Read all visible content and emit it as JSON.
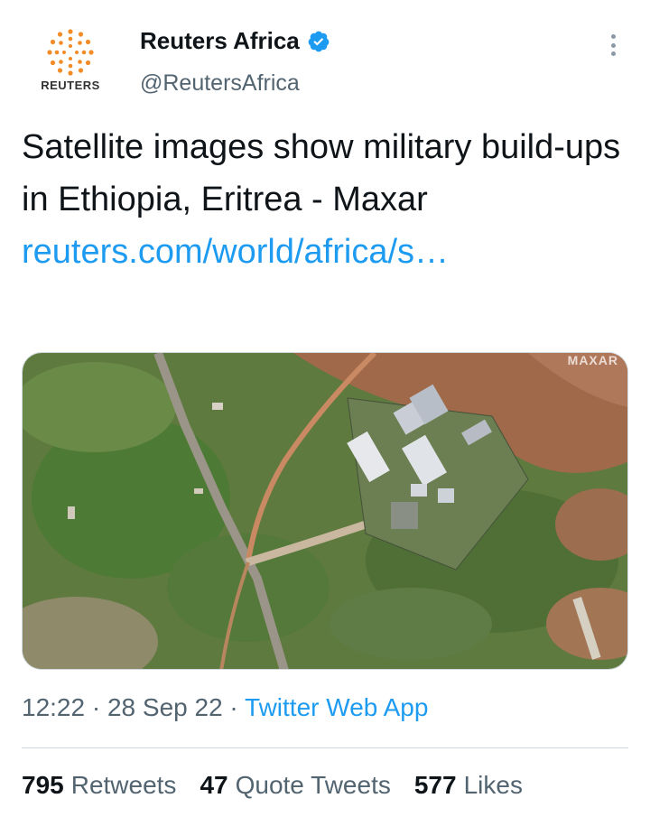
{
  "author": {
    "display_name": "Reuters Africa",
    "handle": "@ReutersAfrica",
    "avatar_wordmark": "REUTERS",
    "verified_icon": "verified-badge-icon"
  },
  "tweet": {
    "text": "Satellite images show military build-ups in Ethiopia, Eritrea - Maxar ",
    "link_text": "reuters.com/world/africa/s…",
    "media_watermark": "MAXAR"
  },
  "meta": {
    "time": "12:22",
    "date": "28 Sep 22",
    "separator": " · ",
    "source": "Twitter Web App"
  },
  "stats": {
    "retweets_count": "795",
    "retweets_label": "Retweets",
    "quotes_count": "47",
    "quotes_label": "Quote Tweets",
    "likes_count": "577",
    "likes_label": "Likes"
  },
  "colors": {
    "link": "#1d9bf0",
    "secondary_text": "#536471",
    "logo_orange": "#f28c28"
  }
}
